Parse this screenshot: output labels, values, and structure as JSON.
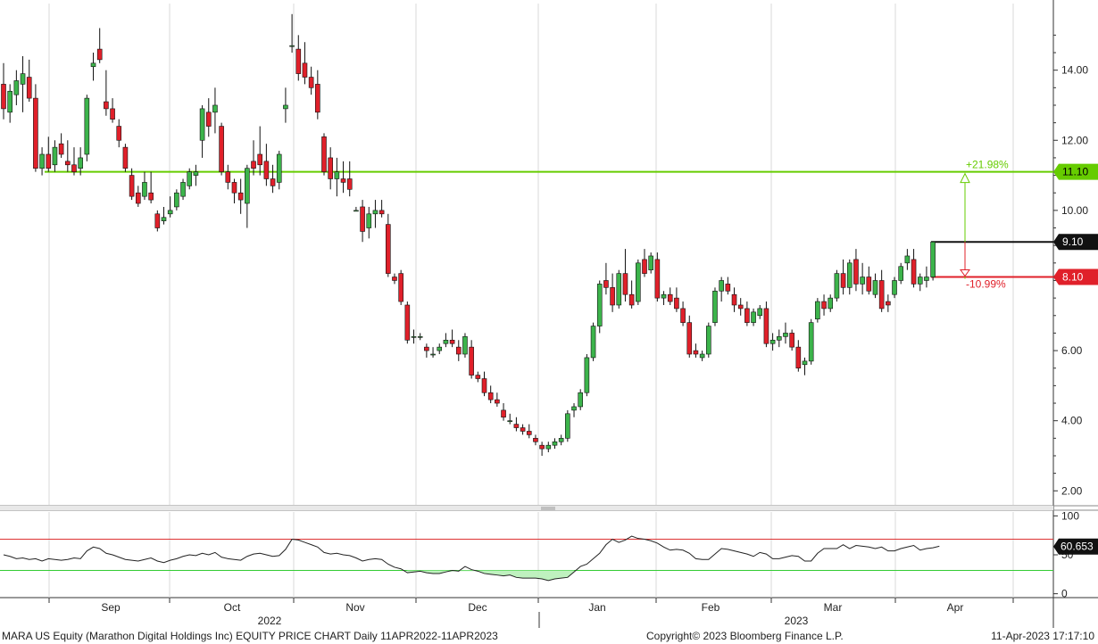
{
  "footer": {
    "title": "MARA US Equity (Marathon Digital Holdings Inc) EQUITY PRICE CHART  Daily 11APR2022-11APR2023",
    "copyright": "Copyright© 2023 Bloomberg Finance L.P.",
    "timestamp": "11-Apr-2023 17:17:10"
  },
  "colors": {
    "up": "#3cb44b",
    "down": "#e0202a",
    "level_line": "#66cc00",
    "oversold": "#33cc33",
    "overbought": "#dd3333",
    "grid": "#d8d8d8"
  },
  "chart_data": [
    {
      "type": "candlestick",
      "title": "",
      "y_axis_position": "right",
      "ylim": [
        1.6,
        15.9
      ],
      "y_ticks": [
        "2.00",
        "4.00",
        "6.00",
        "8.00",
        "10.00",
        "12.00",
        "14.00"
      ],
      "x_labels": [
        "Sep",
        "Oct",
        "Nov",
        "Dec",
        "Jan",
        "Feb",
        "Mar",
        "Apr"
      ],
      "year_labels": [
        "2022",
        "2023"
      ],
      "candles": [
        [
          13.6,
          14.2,
          12.6,
          12.9
        ],
        [
          12.8,
          13.6,
          12.5,
          13.4
        ],
        [
          13.3,
          14.0,
          13.0,
          13.7
        ],
        [
          13.6,
          14.4,
          12.8,
          13.9
        ],
        [
          13.8,
          14.3,
          13.1,
          13.2
        ],
        [
          13.2,
          13.6,
          11.1,
          11.2
        ],
        [
          11.2,
          11.8,
          11.0,
          11.6
        ],
        [
          11.6,
          12.1,
          11.1,
          11.2
        ],
        [
          11.3,
          12.0,
          11.1,
          11.8
        ],
        [
          11.9,
          12.2,
          11.5,
          11.6
        ],
        [
          11.4,
          12.0,
          11.1,
          11.3
        ],
        [
          11.3,
          11.8,
          11.0,
          11.1
        ],
        [
          11.2,
          11.8,
          11.0,
          11.5
        ],
        [
          11.6,
          13.3,
          11.4,
          13.2
        ],
        [
          14.1,
          14.5,
          13.7,
          14.2
        ],
        [
          14.6,
          15.2,
          14.2,
          14.3
        ],
        [
          13.1,
          14.0,
          12.7,
          12.9
        ],
        [
          12.9,
          13.2,
          12.5,
          12.6
        ],
        [
          12.4,
          12.6,
          11.8,
          12.0
        ],
        [
          11.8,
          11.9,
          11.1,
          11.2
        ],
        [
          11.0,
          11.2,
          10.3,
          10.4
        ],
        [
          10.5,
          10.7,
          10.1,
          10.2
        ],
        [
          10.4,
          11.1,
          10.3,
          10.8
        ],
        [
          10.5,
          11.1,
          10.2,
          10.3
        ],
        [
          9.9,
          10.0,
          9.4,
          9.5
        ],
        [
          9.7,
          10.1,
          9.6,
          9.8
        ],
        [
          9.9,
          10.4,
          9.8,
          10.0
        ],
        [
          10.1,
          10.6,
          10.0,
          10.5
        ],
        [
          10.4,
          10.9,
          10.3,
          10.8
        ],
        [
          10.7,
          11.2,
          10.6,
          11.1
        ],
        [
          11.0,
          11.3,
          10.7,
          11.1
        ],
        [
          12.0,
          13.0,
          11.5,
          12.9
        ],
        [
          12.8,
          13.2,
          12.1,
          12.4
        ],
        [
          12.8,
          13.5,
          12.2,
          13.0
        ],
        [
          12.4,
          12.5,
          11.0,
          11.1
        ],
        [
          11.1,
          11.3,
          10.6,
          10.8
        ],
        [
          10.8,
          10.9,
          10.2,
          10.5
        ],
        [
          10.5,
          10.9,
          9.9,
          10.3
        ],
        [
          10.2,
          11.3,
          9.5,
          11.2
        ],
        [
          11.4,
          12.0,
          11.0,
          11.2
        ],
        [
          11.6,
          12.4,
          11.0,
          11.3
        ],
        [
          11.4,
          11.9,
          10.7,
          10.9
        ],
        [
          10.9,
          11.3,
          10.5,
          10.7
        ],
        [
          10.8,
          11.7,
          10.6,
          11.6
        ],
        [
          12.9,
          13.5,
          12.5,
          13.0
        ],
        [
          14.7,
          15.6,
          14.5,
          14.7
        ],
        [
          14.6,
          15.0,
          13.7,
          13.9
        ],
        [
          14.2,
          14.8,
          13.6,
          13.8
        ],
        [
          13.8,
          14.1,
          13.3,
          13.5
        ],
        [
          13.6,
          14.0,
          12.6,
          12.8
        ],
        [
          12.1,
          12.2,
          11.0,
          11.1
        ],
        [
          11.5,
          11.8,
          10.6,
          10.9
        ],
        [
          10.9,
          11.5,
          10.4,
          11.1
        ],
        [
          10.9,
          11.4,
          10.5,
          10.8
        ],
        [
          10.9,
          11.4,
          10.4,
          10.6
        ],
        [
          10.0,
          10.1,
          10.0,
          10.0
        ],
        [
          10.1,
          10.3,
          9.1,
          9.4
        ],
        [
          9.5,
          10.1,
          9.2,
          9.9
        ],
        [
          9.9,
          10.3,
          9.5,
          10.0
        ],
        [
          10.0,
          10.3,
          9.8,
          9.9
        ],
        [
          9.6,
          9.9,
          8.1,
          8.2
        ],
        [
          8.1,
          8.2,
          7.9,
          8.0
        ],
        [
          8.2,
          8.3,
          7.3,
          7.4
        ],
        [
          7.3,
          7.4,
          6.2,
          6.3
        ],
        [
          6.4,
          6.6,
          6.2,
          6.4
        ],
        [
          6.4,
          6.5,
          6.3,
          6.4
        ],
        [
          6.1,
          6.2,
          5.8,
          6.0
        ],
        [
          5.9,
          6.1,
          5.8,
          5.9
        ],
        [
          6.0,
          6.2,
          5.9,
          6.1
        ],
        [
          6.2,
          6.5,
          6.1,
          6.3
        ],
        [
          6.3,
          6.6,
          6.1,
          6.2
        ],
        [
          6.1,
          6.3,
          5.7,
          5.9
        ],
        [
          5.9,
          6.5,
          5.8,
          6.4
        ],
        [
          6.1,
          6.3,
          5.2,
          5.3
        ],
        [
          5.3,
          5.4,
          5.1,
          5.2
        ],
        [
          5.2,
          5.4,
          4.7,
          4.8
        ],
        [
          4.8,
          5.0,
          4.5,
          4.6
        ],
        [
          4.6,
          4.8,
          4.4,
          4.5
        ],
        [
          4.3,
          4.5,
          4.0,
          4.1
        ],
        [
          4.0,
          4.2,
          3.9,
          4.0
        ],
        [
          3.9,
          4.1,
          3.7,
          3.8
        ],
        [
          3.8,
          3.9,
          3.6,
          3.7
        ],
        [
          3.7,
          3.9,
          3.5,
          3.6
        ],
        [
          3.5,
          3.6,
          3.3,
          3.4
        ],
        [
          3.3,
          3.4,
          3.0,
          3.2
        ],
        [
          3.2,
          3.4,
          3.1,
          3.3
        ],
        [
          3.3,
          3.5,
          3.2,
          3.4
        ],
        [
          3.4,
          3.6,
          3.3,
          3.5
        ],
        [
          3.5,
          4.3,
          3.4,
          4.2
        ],
        [
          4.3,
          4.5,
          4.1,
          4.4
        ],
        [
          4.4,
          4.9,
          4.3,
          4.8
        ],
        [
          4.8,
          5.9,
          4.7,
          5.8
        ],
        [
          5.8,
          6.8,
          5.7,
          6.7
        ],
        [
          6.7,
          8.0,
          6.5,
          7.9
        ],
        [
          8.0,
          8.5,
          7.6,
          7.8
        ],
        [
          7.8,
          8.2,
          7.1,
          7.3
        ],
        [
          7.3,
          8.3,
          7.2,
          8.2
        ],
        [
          8.2,
          8.9,
          7.4,
          7.6
        ],
        [
          7.6,
          8.0,
          7.2,
          7.3
        ],
        [
          7.4,
          8.6,
          7.3,
          8.5
        ],
        [
          8.6,
          8.9,
          8.1,
          8.2
        ],
        [
          8.3,
          8.8,
          8.2,
          8.7
        ],
        [
          8.6,
          8.8,
          7.4,
          7.5
        ],
        [
          7.5,
          7.7,
          7.3,
          7.6
        ],
        [
          7.6,
          7.8,
          7.3,
          7.4
        ],
        [
          7.5,
          7.8,
          7.1,
          7.2
        ],
        [
          7.2,
          7.4,
          6.7,
          6.8
        ],
        [
          6.8,
          7.0,
          5.8,
          5.9
        ],
        [
          6.0,
          6.2,
          5.8,
          5.9
        ],
        [
          5.8,
          6.0,
          5.7,
          5.9
        ],
        [
          5.9,
          6.8,
          5.8,
          6.7
        ],
        [
          6.8,
          7.8,
          6.7,
          7.7
        ],
        [
          7.7,
          8.1,
          7.4,
          8.0
        ],
        [
          7.9,
          8.1,
          7.6,
          7.7
        ],
        [
          7.6,
          7.8,
          7.1,
          7.3
        ],
        [
          7.3,
          7.5,
          7.0,
          7.2
        ],
        [
          7.2,
          7.4,
          6.7,
          6.8
        ],
        [
          6.8,
          7.2,
          6.7,
          7.1
        ],
        [
          7.0,
          7.3,
          6.9,
          7.2
        ],
        [
          7.2,
          7.4,
          6.1,
          6.2
        ],
        [
          6.2,
          6.5,
          6.0,
          6.3
        ],
        [
          6.3,
          6.6,
          6.1,
          6.4
        ],
        [
          6.4,
          6.8,
          6.2,
          6.5
        ],
        [
          6.5,
          6.6,
          6.0,
          6.1
        ],
        [
          6.1,
          6.3,
          5.4,
          5.5
        ],
        [
          5.6,
          5.8,
          5.3,
          5.7
        ],
        [
          5.7,
          6.9,
          5.6,
          6.8
        ],
        [
          6.9,
          7.5,
          6.8,
          7.4
        ],
        [
          7.4,
          7.6,
          7.0,
          7.2
        ],
        [
          7.2,
          7.6,
          7.1,
          7.5
        ],
        [
          7.5,
          8.3,
          7.4,
          8.2
        ],
        [
          8.2,
          8.6,
          7.6,
          7.8
        ],
        [
          7.8,
          8.6,
          7.6,
          8.5
        ],
        [
          8.6,
          8.9,
          7.7,
          7.9
        ],
        [
          7.9,
          8.5,
          7.6,
          8.1
        ],
        [
          8.1,
          8.4,
          7.6,
          7.7
        ],
        [
          7.6,
          8.2,
          7.5,
          8.0
        ],
        [
          8.0,
          8.3,
          7.1,
          7.2
        ],
        [
          7.4,
          7.6,
          7.1,
          7.3
        ],
        [
          7.6,
          8.1,
          7.5,
          8.0
        ],
        [
          8.0,
          8.5,
          7.9,
          8.4
        ],
        [
          8.5,
          8.9,
          8.3,
          8.7
        ],
        [
          8.6,
          8.9,
          7.8,
          7.9
        ],
        [
          7.9,
          8.2,
          7.7,
          8.1
        ],
        [
          8.0,
          8.4,
          7.8,
          8.1
        ],
        [
          8.1,
          9.1,
          8.0,
          9.1
        ]
      ],
      "levels": [
        {
          "value": 11.1,
          "label": "11.10",
          "style": "green"
        },
        {
          "value": 9.1,
          "label": "9.10",
          "style": "black"
        },
        {
          "value": 8.1,
          "label": "8.10",
          "style": "red"
        }
      ],
      "annotations": [
        "+21.98%",
        "-10.99%"
      ]
    },
    {
      "type": "line",
      "title": "",
      "ylim": [
        -5,
        105
      ],
      "y_ticks": [
        "0",
        "50",
        "100"
      ],
      "overbought": 70,
      "oversold": 30,
      "last_value": "60.653",
      "values": [
        50,
        48,
        45,
        46,
        44,
        45,
        42,
        45,
        44,
        43,
        44,
        46,
        45,
        55,
        60,
        58,
        52,
        50,
        47,
        44,
        43,
        42,
        44,
        46,
        42,
        40,
        43,
        45,
        48,
        50,
        49,
        52,
        50,
        53,
        47,
        45,
        44,
        43,
        48,
        51,
        52,
        50,
        48,
        49,
        57,
        70,
        69,
        66,
        63,
        60,
        53,
        51,
        52,
        50,
        49,
        46,
        42,
        44,
        45,
        44,
        38,
        34,
        32,
        27,
        28,
        29,
        27,
        26,
        26,
        28,
        30,
        29,
        35,
        31,
        29,
        26,
        25,
        24,
        23,
        24,
        21,
        20,
        20,
        20,
        19,
        17,
        19,
        20,
        21,
        28,
        35,
        38,
        45,
        52,
        63,
        70,
        66,
        69,
        74,
        71,
        70,
        68,
        65,
        60,
        56,
        57,
        56,
        52,
        45,
        44,
        44,
        51,
        58,
        57,
        55,
        53,
        51,
        48,
        53,
        51,
        45,
        45,
        47,
        49,
        48,
        42,
        42,
        52,
        58,
        58,
        58,
        63,
        58,
        62,
        61,
        60,
        58,
        60,
        55,
        55,
        58,
        60,
        62,
        56,
        58,
        59,
        61
      ]
    }
  ]
}
